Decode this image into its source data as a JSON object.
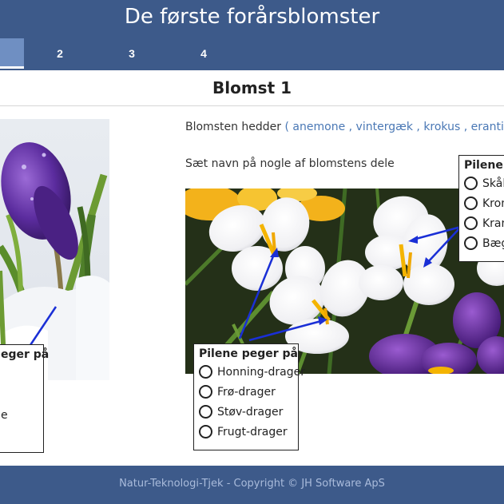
{
  "header": {
    "title": "De første forårsblomster"
  },
  "tabs": [
    {
      "label": ""
    },
    {
      "label": "2"
    },
    {
      "label": "3"
    },
    {
      "label": "4"
    }
  ],
  "section": {
    "title": "Blomst 1"
  },
  "question": {
    "prefix": "Blomsten hedder",
    "open": "(",
    "close": ")",
    "options": [
      "anemone",
      "vintergæk",
      "krokus",
      "erantis"
    ],
    "separator": ","
  },
  "instruction": "Sæt navn på nogle af blomstens dele",
  "left_box": {
    "title": "eger på",
    "trailing": "e"
  },
  "bottom_box": {
    "title": "Pilene peger på",
    "options": [
      "Honning-drager",
      "Frø-drager",
      "Støv-drager",
      "Frugt-drager"
    ]
  },
  "right_box": {
    "title": "Pilene p",
    "options": [
      "Skål-",
      "Kron",
      "Kran",
      "Bæge"
    ]
  },
  "footer": {
    "text": "Natur-Teknologi-Tjek - Copyright © JH Software ApS"
  },
  "colors": {
    "header": "#3d5a8a",
    "link": "#4a78b5",
    "arrow": "#1a2fd6"
  }
}
